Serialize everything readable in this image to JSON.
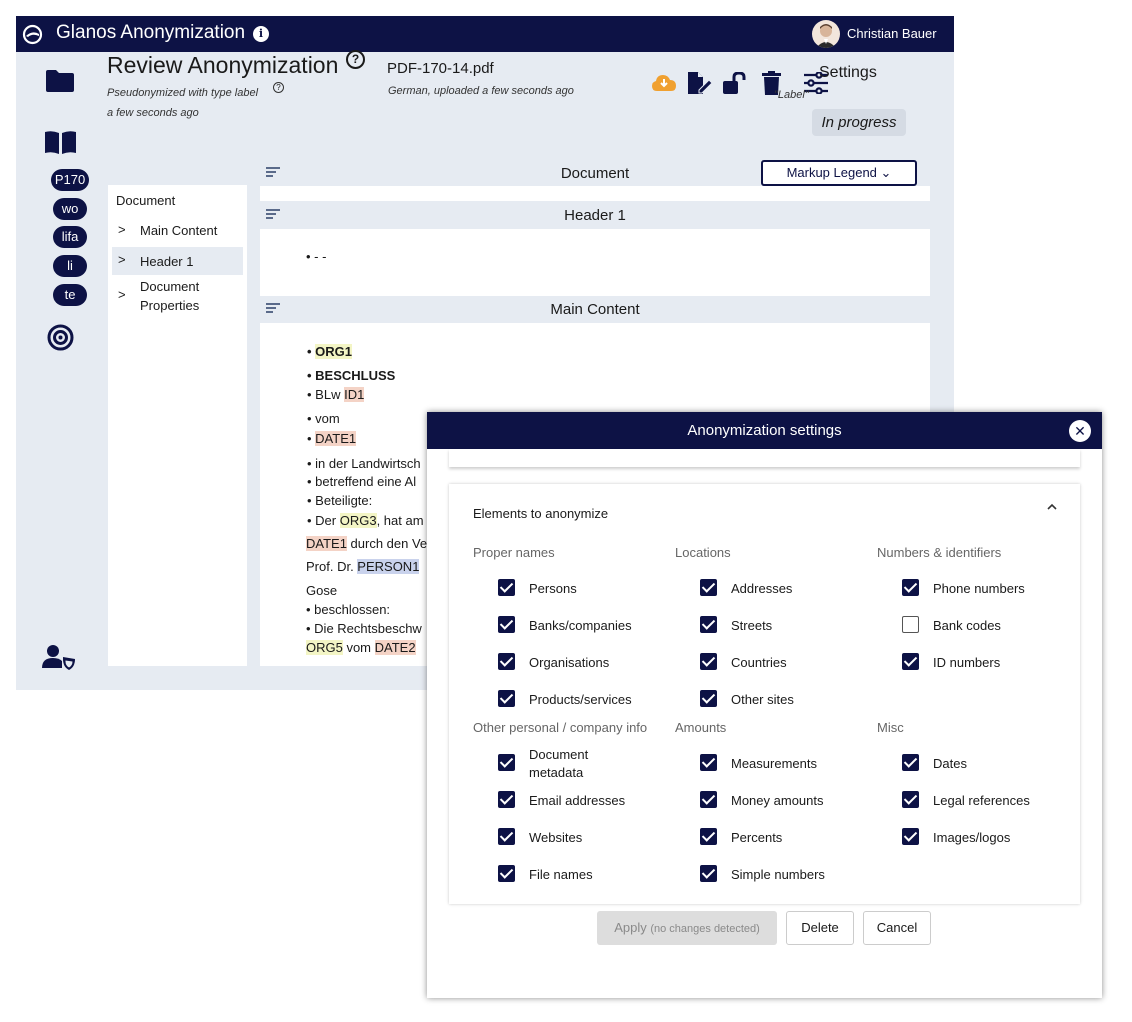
{
  "app": {
    "title": "Glanos Anonymization",
    "user_name": "Christian Bauer"
  },
  "rail": {
    "pills": [
      "P170",
      "wo",
      "lifa",
      "li",
      "te"
    ]
  },
  "review": {
    "title": "Review Anonymization",
    "pseudonymized_text": "Pseudonymized with type label",
    "time_text": "a few seconds ago",
    "file_name": "PDF-170-14.pdf",
    "file_meta": "German, uploaded a few seconds ago",
    "settings_label": "Settings",
    "label_quote": "\"Label\"",
    "status": "In progress"
  },
  "tree": {
    "root": "Document",
    "items": [
      {
        "label": "Main Content"
      },
      {
        "label": "Header 1"
      },
      {
        "label": "Document",
        "label2": "Properties"
      }
    ]
  },
  "sections": {
    "document": "Document",
    "header1": "Header 1",
    "main_content": "Main Content",
    "legend_button": "Markup Legend"
  },
  "doc": {
    "header_bullet": "• - -",
    "lines": {
      "l1_bullet": "• ",
      "l1_org": "ORG1",
      "l2": "• BESCHLUSS",
      "l3_pre": "• BLw ",
      "l3_id": "ID1",
      "l4": "• vom",
      "l5_bullet": "• ",
      "l5_date": "DATE1",
      "l6": "• in der Landwirtsch",
      "l7": "• betreffend eine Al",
      "l8": "• Beteiligte:",
      "l9_pre": "• Der ",
      "l9_org": "ORG3",
      "l9_post": ", hat am",
      "l10_date": "DATE1",
      "l10_post": " durch den Ve",
      "l11_pre": "Prof. Dr. ",
      "l11_person": "PERSON1",
      "l12": "Gose",
      "l13": "• beschlossen:",
      "l14": "• Die Rechtsbeschw",
      "l15_org": "ORG5",
      "l15_mid": " vom ",
      "l15_date": "DATE2"
    }
  },
  "modal": {
    "title": "Anonymization settings",
    "card_title": "Elements to anonymize",
    "groups": [
      {
        "label": "Proper names",
        "options": [
          {
            "label": "Persons",
            "checked": true
          },
          {
            "label": "Banks/companies",
            "checked": true
          },
          {
            "label": "Organisations",
            "checked": true
          },
          {
            "label": "Products/services",
            "checked": true
          }
        ]
      },
      {
        "label": "Locations",
        "options": [
          {
            "label": "Addresses",
            "checked": true
          },
          {
            "label": "Streets",
            "checked": true
          },
          {
            "label": "Countries",
            "checked": true
          },
          {
            "label": "Other sites",
            "checked": true
          }
        ]
      },
      {
        "label": "Numbers & identifiers",
        "options": [
          {
            "label": "Phone numbers",
            "checked": true
          },
          {
            "label": "Bank codes",
            "checked": false
          },
          {
            "label": "ID numbers",
            "checked": true
          }
        ]
      },
      {
        "label": "Other personal / company info",
        "options": [
          {
            "label": "Document",
            "label2": "metadata",
            "checked": true
          },
          {
            "label": "Email addresses",
            "checked": true
          },
          {
            "label": "Websites",
            "checked": true
          },
          {
            "label": "File names",
            "checked": true
          }
        ]
      },
      {
        "label": "Amounts",
        "options": [
          {
            "label": "Measurements",
            "checked": true
          },
          {
            "label": "Money amounts",
            "checked": true
          },
          {
            "label": "Percents",
            "checked": true
          },
          {
            "label": "Simple numbers",
            "checked": true
          }
        ]
      },
      {
        "label": "Misc",
        "options": [
          {
            "label": "Dates",
            "checked": true
          },
          {
            "label": "Legal references",
            "checked": true
          },
          {
            "label": "Images/logos",
            "checked": true
          }
        ]
      }
    ],
    "apply_label": "Apply",
    "apply_hint": "(no changes detected)",
    "delete_label": "Delete",
    "cancel_label": "Cancel"
  },
  "colors": {
    "navy": "#0d1245",
    "cloud_orange": "#f0a030",
    "org_highlight": "#f3f5c5",
    "date_highlight": "#f4d3c6",
    "person_highlight": "#c9d2ec"
  }
}
